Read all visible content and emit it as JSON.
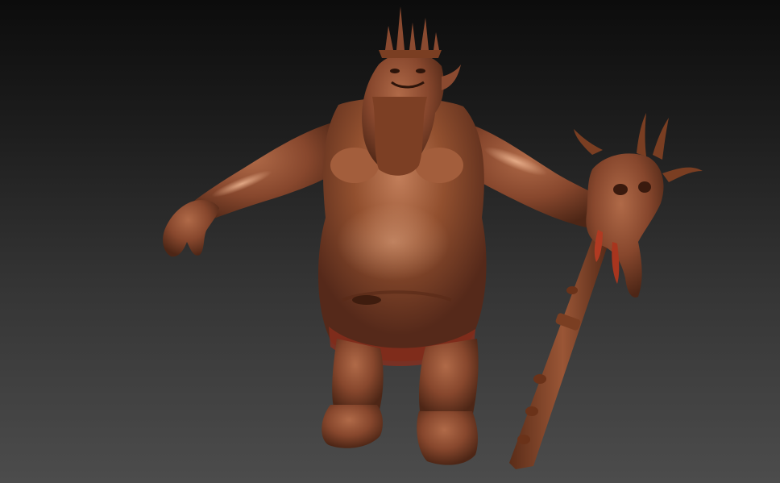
{
  "viewport": {
    "background_top": "#0c0c0c",
    "background_bottom": "#4c4c4c"
  },
  "model": {
    "subject": "ogre-king-sculpt",
    "material_base": "#8a4a30",
    "material_highlight": "#c47a55",
    "material_shadow": "#4a2414",
    "loincloth_color": "#8e2e1c"
  }
}
